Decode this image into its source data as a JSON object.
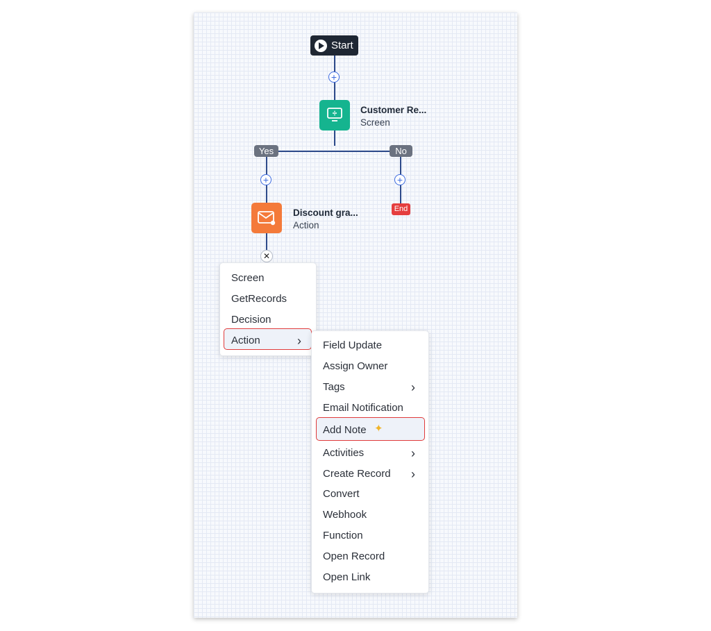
{
  "flow": {
    "start_label": "Start",
    "add_step_symbol": "+",
    "customer_node": {
      "title": "Customer Re...",
      "subtitle": "Screen",
      "color": "#15b48f",
      "icon": "monitor-icon"
    },
    "branch_yes": "Yes",
    "branch_no": "No",
    "end_label": "End",
    "discount_node": {
      "title": "Discount gra...",
      "subtitle": "Action",
      "color": "#f47a3a",
      "icon": "mail-icon"
    },
    "close_symbol": "✕"
  },
  "add_menu": {
    "items": [
      "Screen",
      "GetRecords",
      "Decision",
      "Action"
    ],
    "selected": "Action",
    "chevron": "›"
  },
  "action_submenu": {
    "items": [
      "Field Update",
      "Assign Owner",
      "Tags",
      "Email Notification",
      "Add Note",
      "Activities",
      "Create Record",
      "Convert",
      "Webhook",
      "Function",
      "Open Record",
      "Open Link"
    ],
    "highlighted": "Add Note",
    "chevron": "›",
    "sparkle": "✦"
  },
  "colors": {
    "connector": "#2d4a8a",
    "highlight_border": "#e03a3a",
    "end": "#e53e3e"
  }
}
